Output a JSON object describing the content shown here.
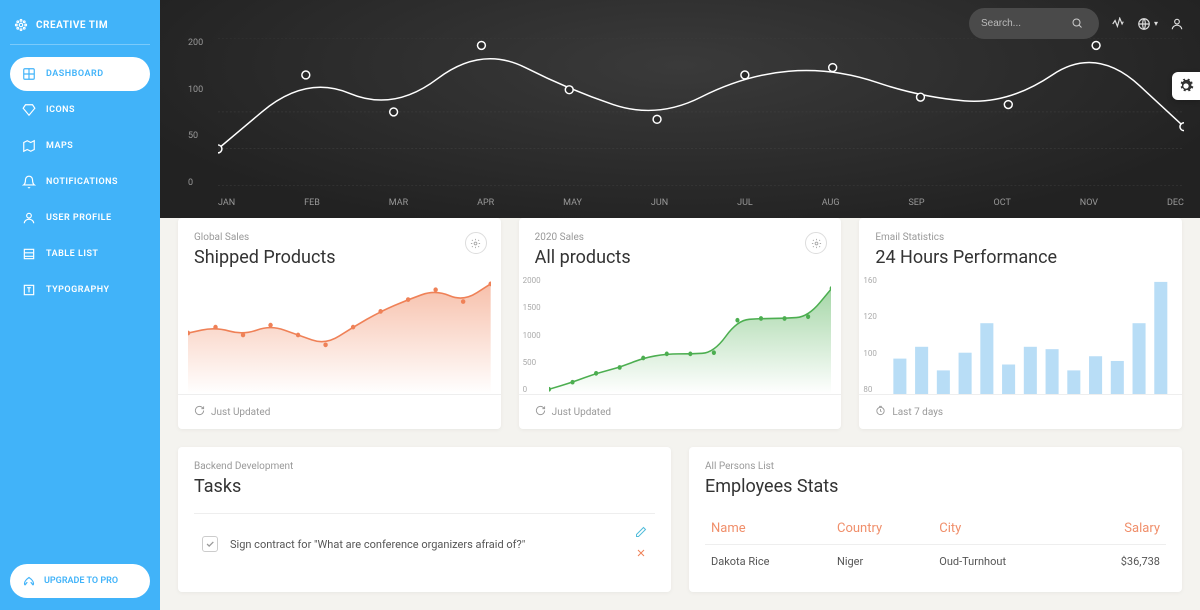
{
  "brand": "CREATIVE TIM",
  "sidebar": {
    "items": [
      {
        "label": "DASHBOARD",
        "icon": "dashboard"
      },
      {
        "label": "ICONS",
        "icon": "diamond"
      },
      {
        "label": "MAPS",
        "icon": "map"
      },
      {
        "label": "NOTIFICATIONS",
        "icon": "bell"
      },
      {
        "label": "USER PROFILE",
        "icon": "user"
      },
      {
        "label": "TABLE LIST",
        "icon": "list"
      },
      {
        "label": "TYPOGRAPHY",
        "icon": "text"
      }
    ],
    "upgrade": "UPGRADE TO PRO"
  },
  "search": {
    "placeholder": "Search..."
  },
  "chart_data": [
    {
      "type": "line",
      "name": "hero",
      "categories": [
        "JAN",
        "FEB",
        "MAR",
        "APR",
        "MAY",
        "JUN",
        "JUL",
        "AUG",
        "SEP",
        "OCT",
        "NOV",
        "DEC"
      ],
      "values": [
        50,
        150,
        100,
        190,
        130,
        90,
        150,
        160,
        120,
        110,
        190,
        80
      ],
      "y_ticks": [
        200,
        100,
        50,
        0
      ],
      "ylim": [
        0,
        200
      ]
    },
    {
      "type": "area",
      "name": "shipped",
      "category": "Global Sales",
      "title": "Shipped Products",
      "footer": "Just Updated",
      "color": "#ef8157",
      "values": [
        310,
        340,
        300,
        350,
        300,
        250,
        340,
        420,
        480,
        530,
        470,
        560
      ]
    },
    {
      "type": "area",
      "name": "all-products",
      "category": "2020 Sales",
      "title": "All products",
      "footer": "Just Updated",
      "color": "#4cae50",
      "y_ticks": [
        "2000",
        "1500",
        "1000",
        "500",
        "0"
      ],
      "values": [
        80,
        200,
        350,
        450,
        610,
        680,
        680,
        700,
        1250,
        1280,
        1280,
        1310,
        1790
      ]
    },
    {
      "type": "bar",
      "name": "email-stats",
      "category": "Email Statistics",
      "title": "24 Hours Performance",
      "footer": "Last 7 days",
      "color": "#7ec1ef",
      "y_ticks": [
        "160",
        "120",
        "100",
        "80"
      ],
      "values": [
        90,
        100,
        80,
        95,
        120,
        85,
        100,
        98,
        80,
        92,
        88,
        120,
        155
      ]
    }
  ],
  "tasks": {
    "category": "Backend Development",
    "title": "Tasks",
    "items": [
      {
        "text": "Sign contract for \"What are conference organizers afraid of?\"",
        "checked": true
      }
    ]
  },
  "employees": {
    "category": "All Persons List",
    "title": "Employees Stats",
    "headers": [
      "Name",
      "Country",
      "City",
      "Salary"
    ],
    "rows": [
      [
        "Dakota Rice",
        "Niger",
        "Oud-Turnhout",
        "$36,738"
      ]
    ]
  }
}
